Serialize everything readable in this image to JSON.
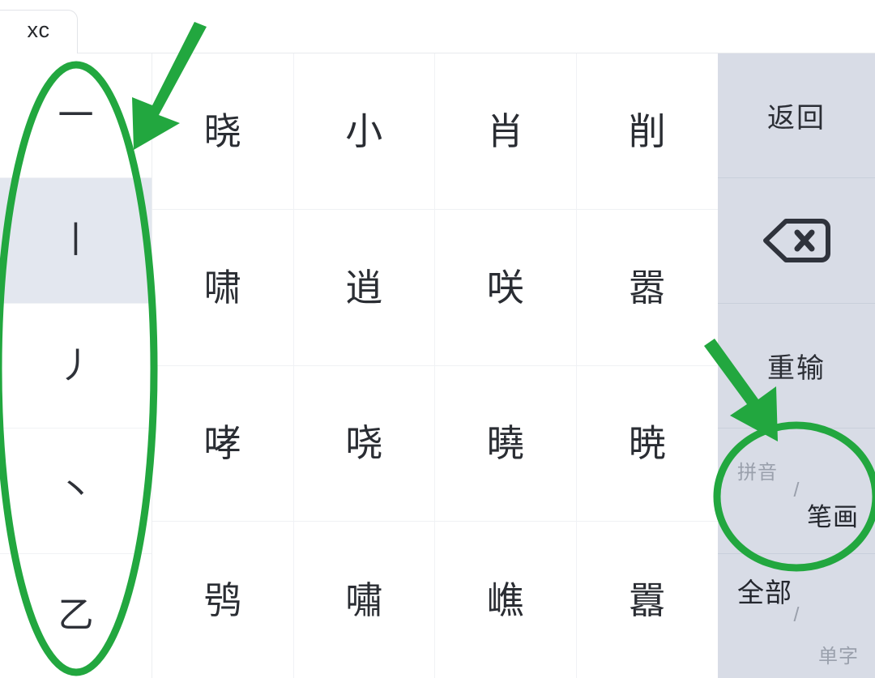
{
  "tab": {
    "label": "xc"
  },
  "stroke_column": {
    "name": "stroke-filter",
    "items": [
      {
        "glyph": "一",
        "name": "heng",
        "active": false
      },
      {
        "glyph": "丨",
        "name": "shu",
        "active": true
      },
      {
        "glyph": "丿",
        "name": "pie",
        "active": false
      },
      {
        "glyph": "丶",
        "name": "dian",
        "active": false
      },
      {
        "glyph": "乙",
        "name": "zhe",
        "active": false
      }
    ]
  },
  "candidates": {
    "rows": [
      [
        "晓",
        "小",
        "肖",
        "削"
      ],
      [
        "啸",
        "逍",
        "咲",
        "嚣"
      ],
      [
        "哮",
        "哓",
        "曉",
        "暁"
      ],
      [
        "鸮",
        "嘯",
        "嶕",
        "囂"
      ]
    ]
  },
  "sidebar": {
    "back_label": "返回",
    "backspace_icon": "backspace-icon",
    "reinput_label": "重输",
    "mode_toggle": {
      "top_label": "拼音",
      "slash": "/",
      "bottom_label": "笔画",
      "active": "bottom"
    },
    "scope_toggle": {
      "top_label": "全部",
      "slash": "/",
      "bottom_label": "单字",
      "active": "top"
    }
  },
  "annotations": {
    "accent_color": "#22a73f",
    "ellipse_stroke_column": "highlight-stroke-column",
    "ellipse_mode_toggle": "highlight-mode-toggle",
    "arrow_to_strokes": "arrow-pointing-stroke-column",
    "arrow_to_toggle": "arrow-pointing-mode-toggle"
  },
  "colors": {
    "grid_bg": "#ffffff",
    "sidebar_bg": "#d8dce6",
    "active_stroke_bg": "#e3e7ef",
    "text": "#2a2d33",
    "muted_text": "#9aa0ac"
  }
}
